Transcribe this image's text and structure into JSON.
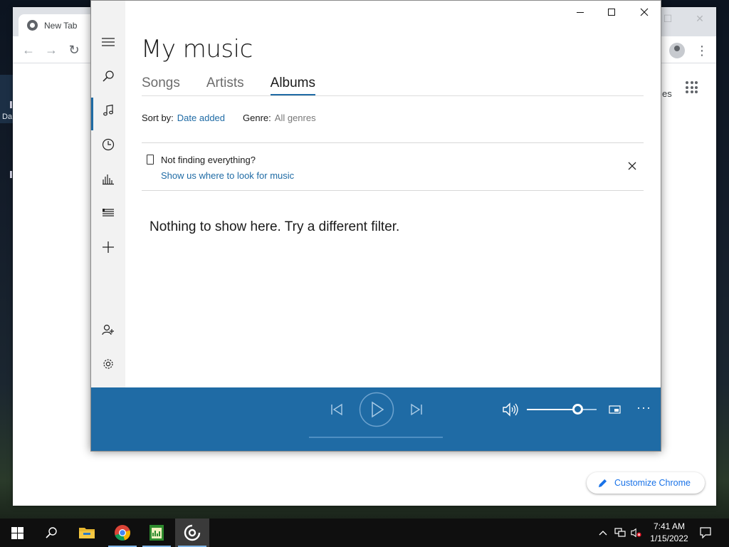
{
  "desktop": {
    "icon_label": "Da"
  },
  "chrome": {
    "tab_title": "New Tab",
    "partial_text": "es",
    "customize_label": "Customize Chrome"
  },
  "groove": {
    "title": "My music",
    "tabs": [
      {
        "label": "Songs",
        "active": false
      },
      {
        "label": "Artists",
        "active": false
      },
      {
        "label": "Albums",
        "active": true
      }
    ],
    "sort_label": "Sort by:",
    "sort_value": "Date added",
    "genre_label": "Genre:",
    "genre_value": "All genres",
    "notice_title": "Not finding everything?",
    "notice_link": "Show us where to look for music",
    "empty_message": "Nothing to show here. Try a different filter.",
    "nav_icons": [
      "hamburger-icon",
      "search-icon",
      "music-note-icon",
      "clock-icon",
      "equalizer-icon",
      "playlist-icon",
      "plus-icon",
      "add-person-icon",
      "gear-icon"
    ],
    "volume_level_percent": 73,
    "accent_color": "#1f6ba5"
  },
  "taskbar": {
    "time": "7:41 AM",
    "date": "1/15/2022",
    "apps": [
      "start-icon",
      "search-icon",
      "file-explorer-icon",
      "chrome-icon",
      "spreadsheet-icon",
      "groove-music-icon"
    ]
  }
}
